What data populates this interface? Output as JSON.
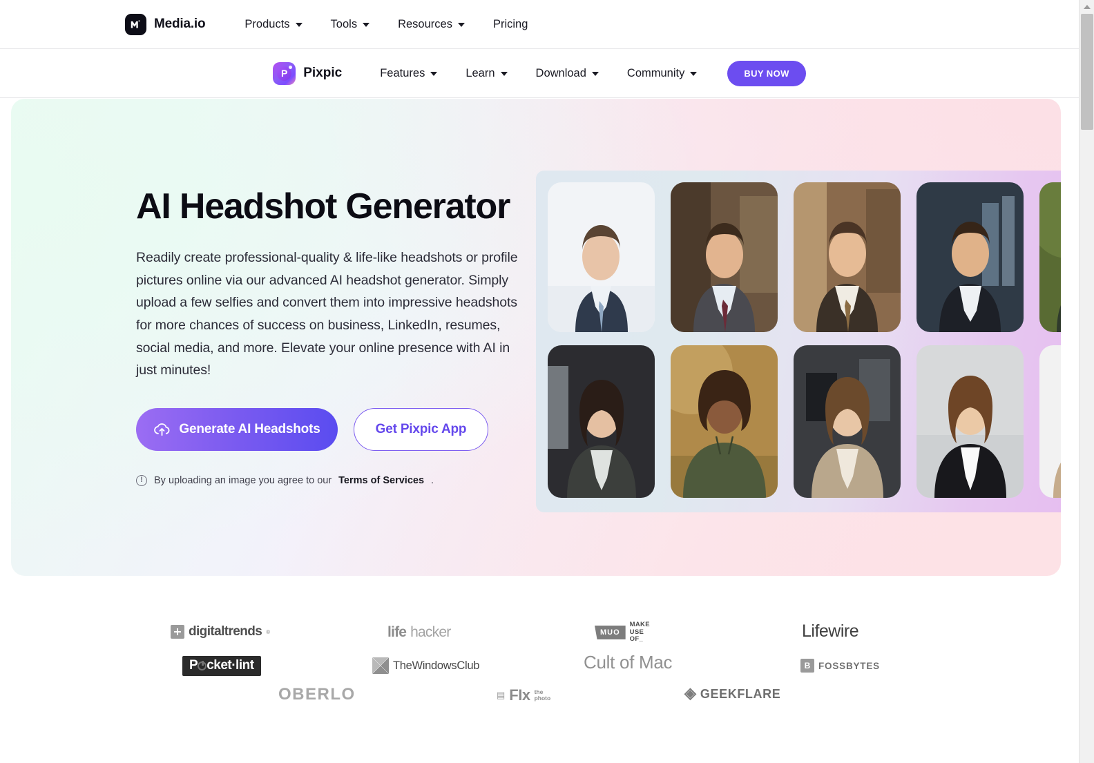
{
  "top_nav": {
    "brand": {
      "name": "Media.io",
      "logo_icon": "mediaio-logo-icon"
    },
    "links": [
      {
        "label": "Products",
        "has_caret": true
      },
      {
        "label": "Tools",
        "has_caret": true
      },
      {
        "label": "Resources",
        "has_caret": true
      },
      {
        "label": "Pricing",
        "has_caret": false
      }
    ]
  },
  "sub_nav": {
    "brand": {
      "name": "Pixpic",
      "logo_icon": "pixpic-logo-icon",
      "letter": "P"
    },
    "links": [
      {
        "label": "Features",
        "has_caret": true
      },
      {
        "label": "Learn",
        "has_caret": true
      },
      {
        "label": "Download",
        "has_caret": true
      },
      {
        "label": "Community",
        "has_caret": true
      }
    ],
    "buy_now_label": "BUY NOW",
    "buy_now_color": "#6c4df0"
  },
  "hero": {
    "title": "AI Headshot Generator",
    "description": "Readily create professional-quality & life-like headshots or profile pictures online via our advanced AI headshot generator. Simply upload a few selfies and convert them into impressive headshots for more chances of success on business, LinkedIn, resumes, social media, and more. Elevate your online presence with AI in just minutes!",
    "primary_cta": {
      "label": "Generate AI Headshots",
      "icon": "cloud-upload-icon"
    },
    "secondary_cta": {
      "label": "Get Pixpic App"
    },
    "terms": {
      "icon": "info-icon",
      "prefix": "By uploading an image you agree to our ",
      "link_label": "Terms of Services",
      "suffix": "."
    },
    "gradient": {
      "start": "#eafaf3",
      "mid": "#f3f2fb",
      "end": "#fde0e5"
    }
  },
  "collage": {
    "background_gradient": {
      "start": "#dfe8f0",
      "end": "#e6bdf0"
    },
    "row_1": [
      {
        "alt": "man in navy suit with blue tie",
        "skin": "#e8c4a8",
        "bg": "#f2f4f7",
        "hair": "#5a4433",
        "suit": "#2f3a4c",
        "shirt": "#eef2f6",
        "tie": "#8fa7c2"
      },
      {
        "alt": "smiling man in grey suit with maroon tie",
        "skin": "#e2b48f",
        "bg": "#6b5540",
        "hair": "#3c2b1d",
        "suit": "#4a4a50",
        "shirt": "#e6ecf2",
        "tie": "#6b2b38"
      },
      {
        "alt": "smiling man with beard in dark suit and tan tie",
        "skin": "#e6bb95",
        "bg": "#8a6a4c",
        "hair": "#4a3425",
        "suit": "#3a3027",
        "shirt": "#f0ece3",
        "tie": "#8a6b42"
      },
      {
        "alt": "man in black blazer with white open-collar shirt",
        "skin": "#e0b289",
        "bg": "#2f3a46",
        "hair": "#362518",
        "suit": "#1d2027",
        "shirt": "#eef1f4",
        "tie": ""
      },
      {
        "alt": "smiling man in dark green t-shirt outdoors",
        "skin": "#d8a87c",
        "bg": "#596b33",
        "hair": "#2c2016",
        "suit": "#2f3a2c",
        "shirt": "#2f3a2c",
        "tie": ""
      }
    ],
    "row_2": [
      {
        "alt": "woman with long dark wavy hair in grey blazer",
        "skin": "#e5c0a2",
        "bg": "#2c2c30",
        "hair": "#2a1d17",
        "suit": "#3c3f3c",
        "shirt": "#dfe3e0",
        "tie": ""
      },
      {
        "alt": "smiling woman with curly hair in olive hoodie outdoors",
        "skin": "#8a5a3c",
        "bg": "#b08a4a",
        "hair": "#3a2415",
        "suit": "#4e5a3c",
        "shirt": "#4e5a3c",
        "tie": ""
      },
      {
        "alt": "woman with long light brown hair in beige blazer",
        "skin": "#e8c6a6",
        "bg": "#3a3c40",
        "hair": "#6b4a2c",
        "suit": "#b9a78c",
        "shirt": "#efe8dc",
        "tie": ""
      },
      {
        "alt": "smiling woman with brown hair in black blazer",
        "skin": "#ebc9a6",
        "bg": "#d7d9da",
        "hair": "#6e4526",
        "suit": "#18181c",
        "shirt": "#fafafa",
        "tie": ""
      },
      {
        "alt": "woman with wavy hair in tan jacket",
        "skin": "#e9c7a5",
        "bg": "#f2f2f2",
        "hair": "#70492a",
        "suit": "#c6ac8c",
        "shirt": "#efe6d8",
        "tie": ""
      }
    ]
  },
  "press_logos": [
    {
      "id": "digitaltrends",
      "name": "digitaltrends",
      "reg": "®"
    },
    {
      "id": "lifehacker",
      "name_bold": "life",
      "name_thin": "hacker"
    },
    {
      "id": "makeuseof",
      "badge": "MUO",
      "line1": "MAKE",
      "line2": "USE",
      "line3": "OF_"
    },
    {
      "id": "lifewire",
      "name": "Lifewire"
    },
    {
      "id": "pocketlint",
      "prefix": "P",
      "suffix": "cket·lint"
    },
    {
      "id": "thewindowsclub",
      "name": "TheWindowsClub"
    },
    {
      "id": "cultofmac",
      "name": "Cult of Mac"
    },
    {
      "id": "fossbytes",
      "mark": "B",
      "name": "FOSSBYTES"
    },
    {
      "id": "oberlo",
      "name": "OBERLO"
    },
    {
      "id": "fixthephoto",
      "name": "FIx",
      "line1": "the",
      "line2": "photo"
    },
    {
      "id": "geekflare",
      "name": "GEEKFLARE"
    }
  ],
  "scrollbar": {
    "position": "right",
    "thumb_color": "#c1c1c1",
    "track_color": "#f1f1f1"
  }
}
